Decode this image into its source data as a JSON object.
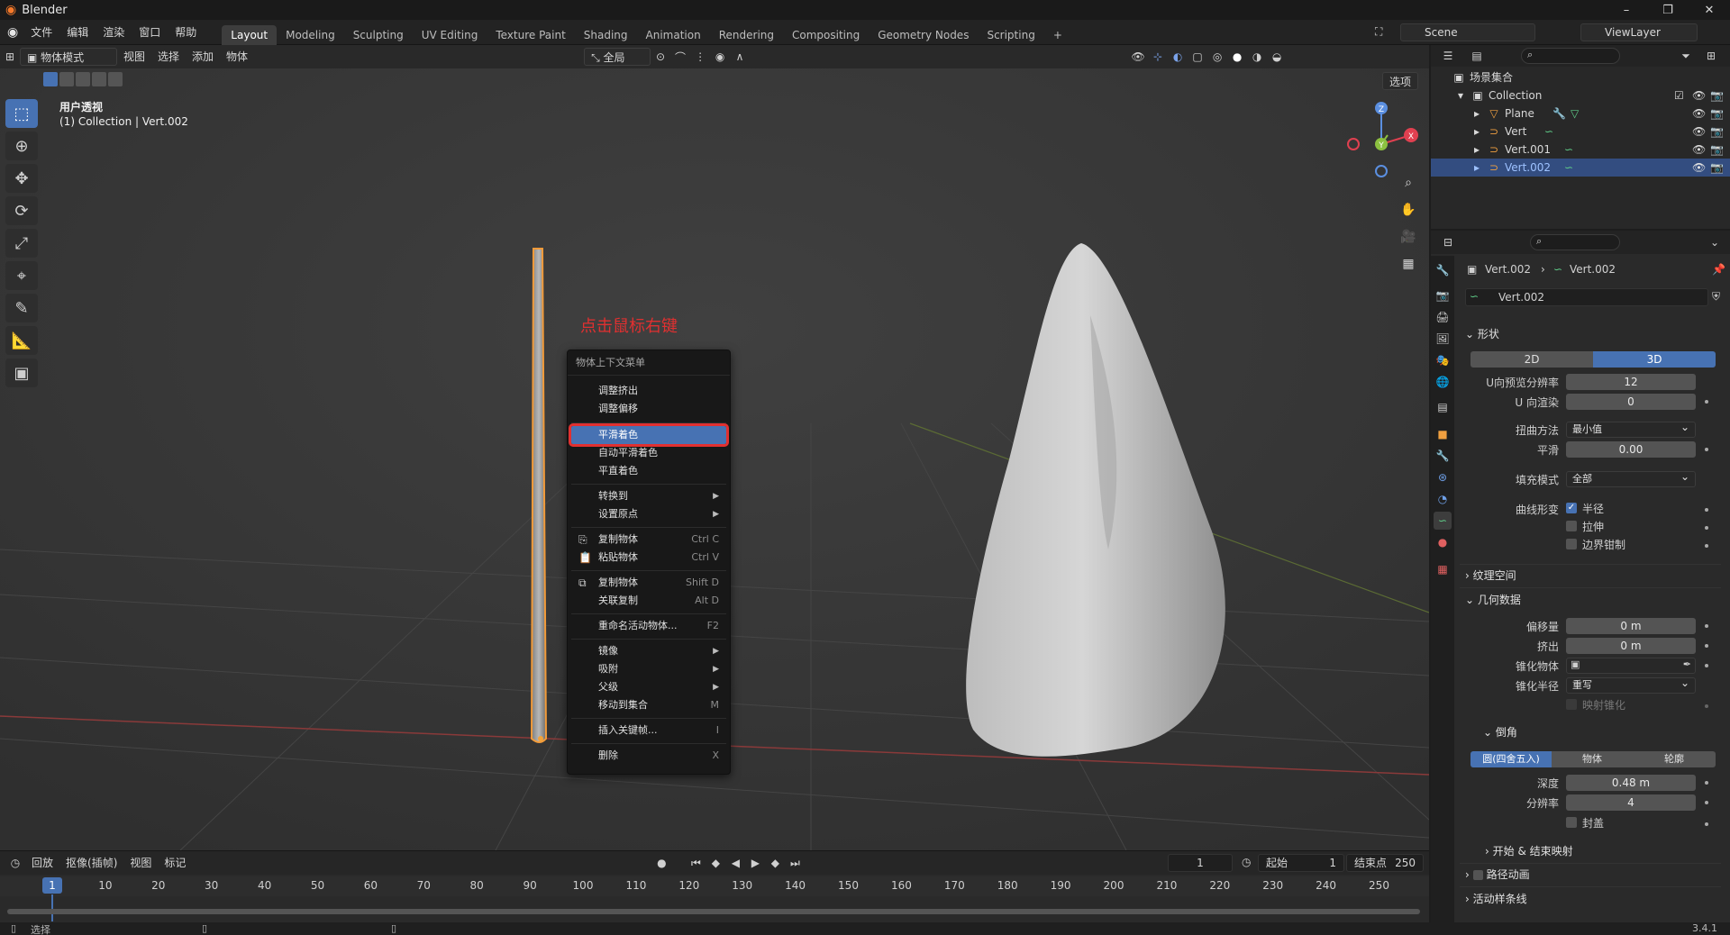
{
  "titlebar": {
    "title": "Blender",
    "min": "–",
    "max": "❐",
    "close": "✕"
  },
  "menu": [
    "文件",
    "编辑",
    "渲染",
    "窗口",
    "帮助"
  ],
  "workspaces": [
    "Layout",
    "Modeling",
    "Sculpting",
    "UV Editing",
    "Texture Paint",
    "Shading",
    "Animation",
    "Rendering",
    "Compositing",
    "Geometry Nodes",
    "Scripting",
    "+"
  ],
  "scene": {
    "name": "Scene",
    "view_layer": "ViewLayer"
  },
  "viewport_header": {
    "mode": "物体模式",
    "menus": [
      "视图",
      "选择",
      "添加",
      "物体"
    ],
    "transform_orientation": "全局",
    "options": "选项"
  },
  "viewport": {
    "view_name": "用户透视",
    "collection_line": "(1) Collection | Vert.002",
    "annotation": "点击鼠标右键",
    "annotation_color": "#e03030"
  },
  "context_menu": {
    "title": "物体上下文菜单",
    "items": [
      {
        "label": "调整挤出",
        "shortcut": ""
      },
      {
        "label": "调整偏移",
        "shortcut": ""
      },
      {
        "label": "平滑着色",
        "shortcut": ""
      },
      {
        "label": "自动平滑着色",
        "shortcut": ""
      },
      {
        "label": "平直着色",
        "shortcut": ""
      },
      {
        "label": "转换到",
        "shortcut": ""
      },
      {
        "label": "设置原点",
        "shortcut": ""
      },
      {
        "label": "复制物体",
        "shortcut": "Ctrl C"
      },
      {
        "label": "粘贴物体",
        "shortcut": "Ctrl V"
      },
      {
        "label": "复制物体",
        "shortcut": "Shift D"
      },
      {
        "label": "关联复制",
        "shortcut": "Alt D"
      },
      {
        "label": "重命名活动物体...",
        "shortcut": "F2"
      },
      {
        "label": "镜像",
        "shortcut": ""
      },
      {
        "label": "吸附",
        "shortcut": ""
      },
      {
        "label": "父级",
        "shortcut": ""
      },
      {
        "label": "移动到集合",
        "shortcut": "M"
      },
      {
        "label": "插入关键帧...",
        "shortcut": "I"
      },
      {
        "label": "删除",
        "shortcut": "X"
      }
    ]
  },
  "gizmo": {
    "z": "Z",
    "y": "Y",
    "x": "X"
  },
  "outliner": {
    "scene_collection": "场景集合",
    "collection": "Collection",
    "objects": [
      "Plane",
      "Vert",
      "Vert.001",
      "Vert.002"
    ]
  },
  "properties": {
    "breadcrumb_object": "Vert.002",
    "breadcrumb_data": "Vert.002",
    "data_name": "Vert.002",
    "shape_section": "形状",
    "dim_2d": "2D",
    "dim_3d": "3D",
    "u_preview_label": "U向预览分辨率",
    "u_preview_value": "12",
    "u_render_label": "U 向渲染",
    "u_render_value": "0",
    "twist_label": "扭曲方法",
    "twist_value": "最小值",
    "smooth_label": "平滑",
    "smooth_value": "0.00",
    "fill_label": "填充模式",
    "fill_value": "全部",
    "curve_deform_label": "曲线形变",
    "cb_radius": "半径",
    "cb_stretch": "拉伸",
    "cb_bounds": "边界钳制",
    "texture_space": "纹理空间",
    "geometry_section": "几何数据",
    "offset_label": "偏移量",
    "offset_value": "0 m",
    "extrude_label": "挤出",
    "extrude_value": "0 m",
    "taper_obj_label": "锥化物体",
    "taper_radius_label": "锥化半径",
    "taper_radius_value": "重写",
    "map_taper": "映射锥化",
    "bevel_section": "倒角",
    "bevel_round": "圆(四舍五入)",
    "bevel_object": "物体",
    "bevel_profile": "轮廓",
    "depth_label": "深度",
    "depth_value": "0.48 m",
    "resolution_label": "分辨率",
    "resolution_value": "4",
    "fill_caps": "封盖",
    "start_end": "开始 & 结束映射",
    "path_anim": "路径动画",
    "active_spline": "活动样条线"
  },
  "timeline": {
    "playback": "回放",
    "keying": "抠像(插帧)",
    "view": "视图",
    "marker": "标记",
    "current_frame": "1",
    "start_label": "起始",
    "start_value": "1",
    "end_label": "结束点",
    "end_value": "250",
    "ruler": [
      "1",
      "10",
      "20",
      "30",
      "40",
      "50",
      "60",
      "70",
      "80",
      "90",
      "100",
      "110",
      "120",
      "130",
      "140",
      "150",
      "160",
      "170",
      "180",
      "190",
      "200",
      "210",
      "220",
      "230",
      "240",
      "250"
    ]
  },
  "statusbar": {
    "select": "选择",
    "version": "3.4.1"
  }
}
